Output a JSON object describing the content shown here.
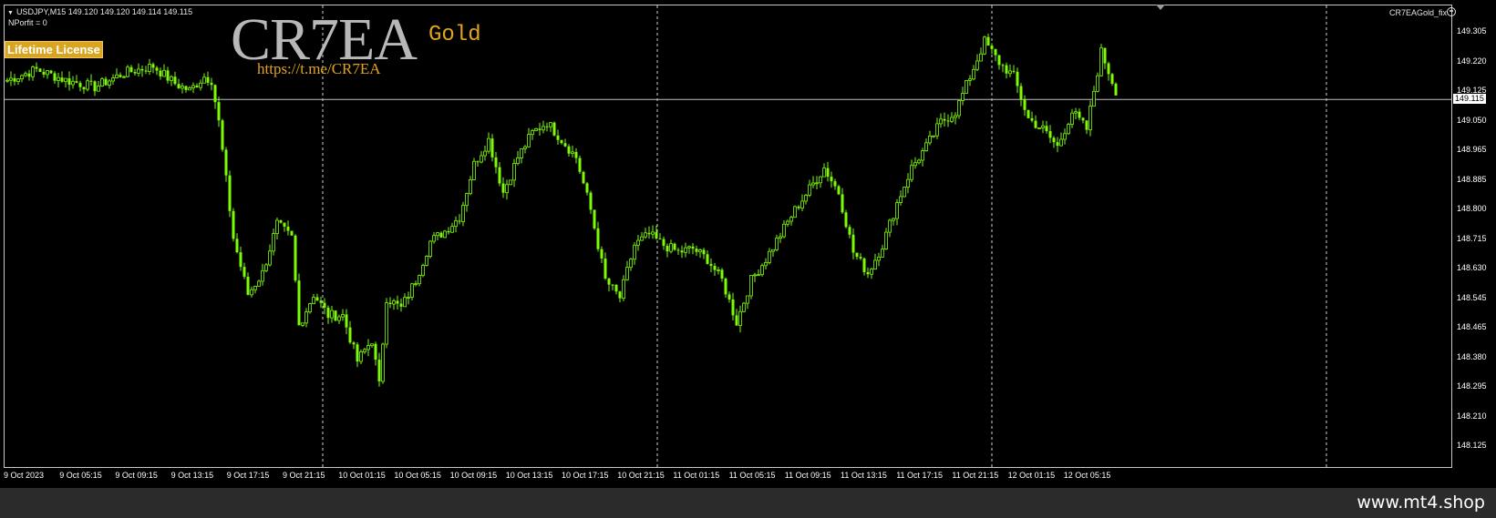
{
  "chart_header": {
    "symbol_info": "USDJPY,M15  149.120 149.120 149.114 149.115",
    "nprofit": "NPorfit = 0",
    "ea_name": "CR7EAGold_fix"
  },
  "badge": {
    "label": "Lifetime License"
  },
  "logo": {
    "text": "CR7EA",
    "subtitle": "Gold",
    "link": "https://t.me/CR7EA"
  },
  "price_axis": {
    "labels": [
      "149.305",
      "149.220",
      "149.125",
      "149.050",
      "148.965",
      "148.885",
      "148.800",
      "148.715",
      "148.630",
      "148.545",
      "148.465",
      "148.380",
      "148.295",
      "148.210",
      "148.125"
    ],
    "current_price": "149.115"
  },
  "time_axis": {
    "labels": [
      "9 Oct 2023",
      "9 Oct 05:15",
      "9 Oct 09:15",
      "9 Oct 13:15",
      "9 Oct 17:15",
      "9 Oct 21:15",
      "10 Oct 01:15",
      "10 Oct 05:15",
      "10 Oct 09:15",
      "10 Oct 13:15",
      "10 Oct 17:15",
      "10 Oct 21:15",
      "11 Oct 01:15",
      "11 Oct 05:15",
      "11 Oct 09:15",
      "11 Oct 13:15",
      "11 Oct 17:15",
      "11 Oct 21:15",
      "12 Oct 01:15",
      "12 Oct 05:15"
    ]
  },
  "footer": {
    "brand": "www.mt4.shop"
  },
  "colors": {
    "candles": "#7cfc00",
    "background": "#000000",
    "bid_line": "#c0c0c0",
    "badge": "#d9a520",
    "logo_accent": "#e0a41c"
  },
  "chart_data": {
    "type": "candlestick",
    "symbol": "USDJPY",
    "timeframe": "M15",
    "ylim": [
      148.125,
      149.345
    ],
    "bid": 149.115,
    "period_separators": [
      "10 Oct 00:00",
      "11 Oct 00:00",
      "12 Oct 00:00",
      "13 Oct 00:00"
    ],
    "close_path": [
      [
        0,
        149.17
      ],
      [
        8,
        149.2
      ],
      [
        16,
        149.17
      ],
      [
        24,
        149.15
      ],
      [
        32,
        149.19
      ],
      [
        40,
        149.21
      ],
      [
        46,
        149.16
      ],
      [
        50,
        149.14
      ],
      [
        54,
        149.18
      ],
      [
        56,
        149.17
      ],
      [
        58,
        149.05
      ],
      [
        62,
        148.72
      ],
      [
        66,
        148.56
      ],
      [
        70,
        148.62
      ],
      [
        74,
        148.76
      ],
      [
        78,
        148.72
      ],
      [
        80,
        148.47
      ],
      [
        84,
        148.56
      ],
      [
        88,
        148.5
      ],
      [
        92,
        148.5
      ],
      [
        96,
        148.37
      ],
      [
        100,
        148.43
      ],
      [
        102,
        148.3
      ],
      [
        104,
        148.55
      ],
      [
        108,
        148.52
      ],
      [
        112,
        148.6
      ],
      [
        116,
        148.71
      ],
      [
        120,
        148.74
      ],
      [
        124,
        148.78
      ],
      [
        128,
        148.93
      ],
      [
        132,
        149.0
      ],
      [
        136,
        148.85
      ],
      [
        140,
        148.95
      ],
      [
        144,
        149.02
      ],
      [
        148,
        149.05
      ],
      [
        152,
        149.0
      ],
      [
        156,
        148.95
      ],
      [
        160,
        148.8
      ],
      [
        164,
        148.6
      ],
      [
        168,
        148.55
      ],
      [
        172,
        148.7
      ],
      [
        176,
        148.73
      ],
      [
        180,
        148.7
      ],
      [
        184,
        148.68
      ],
      [
        188,
        148.69
      ],
      [
        192,
        148.66
      ],
      [
        196,
        148.6
      ],
      [
        200,
        148.48
      ],
      [
        204,
        148.6
      ],
      [
        208,
        148.66
      ],
      [
        212,
        148.73
      ],
      [
        216,
        148.8
      ],
      [
        220,
        148.86
      ],
      [
        224,
        148.92
      ],
      [
        228,
        148.85
      ],
      [
        232,
        148.68
      ],
      [
        236,
        148.62
      ],
      [
        240,
        148.7
      ],
      [
        244,
        148.82
      ],
      [
        248,
        148.92
      ],
      [
        252,
        148.98
      ],
      [
        256,
        149.05
      ],
      [
        260,
        149.08
      ],
      [
        264,
        149.18
      ],
      [
        268,
        149.28
      ],
      [
        272,
        149.22
      ],
      [
        276,
        149.18
      ],
      [
        280,
        149.06
      ],
      [
        284,
        149.03
      ],
      [
        288,
        148.98
      ],
      [
        292,
        149.08
      ],
      [
        296,
        149.03
      ],
      [
        300,
        149.25
      ],
      [
        304,
        149.14
      ]
    ]
  }
}
